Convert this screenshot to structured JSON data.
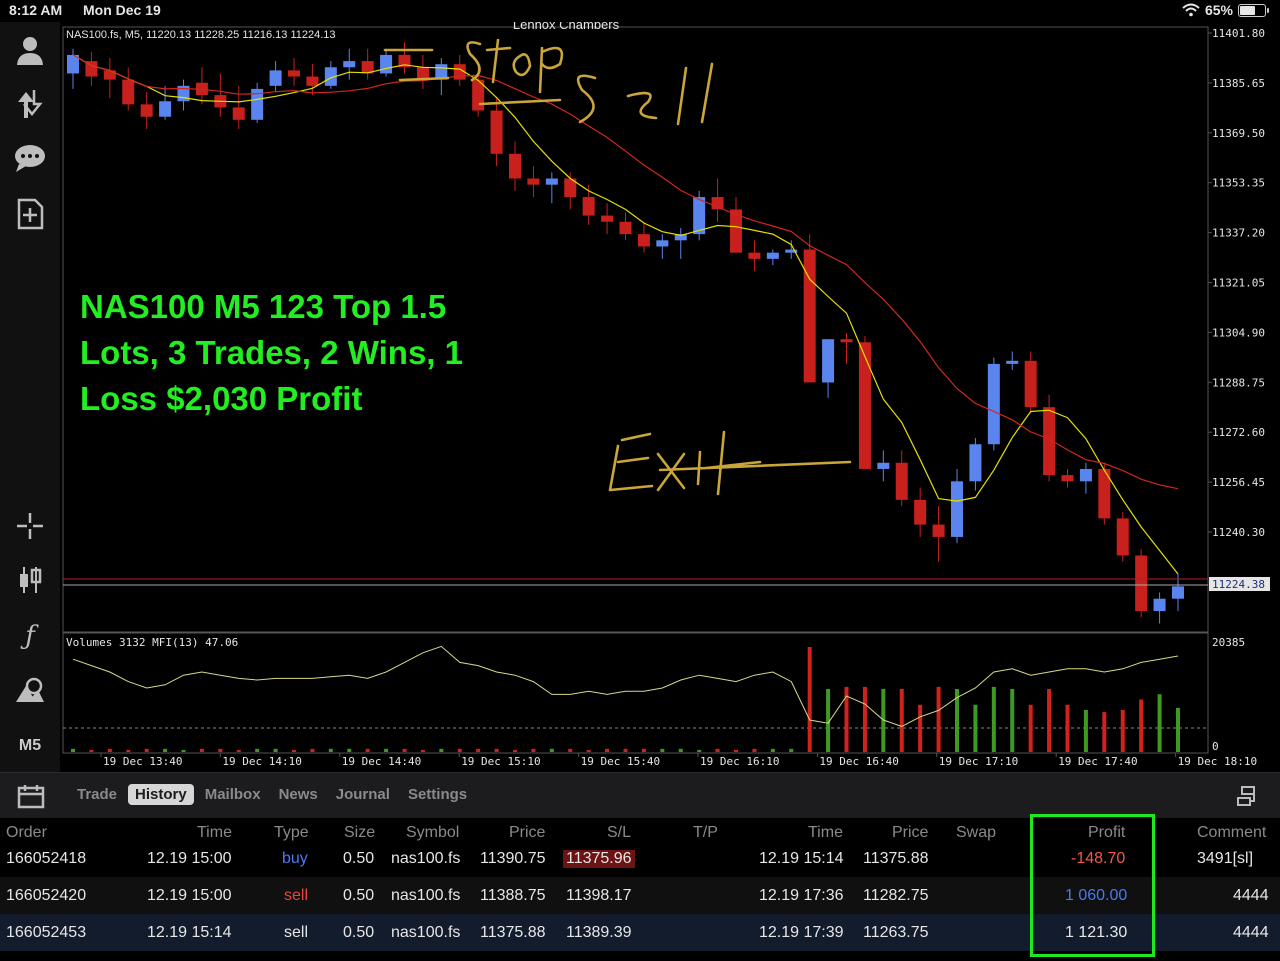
{
  "status_bar": {
    "time": "8:12 AM",
    "date": "Mon Dec 19",
    "battery": "65%",
    "battery_level": 0.65
  },
  "chart": {
    "owner": "Lennox Chambers",
    "info_line": "NAS100.fs, M5, 11220.13 11228.25 11216.13 11224.13",
    "annotation_lines": [
      "NAS100 M5 123 Top 1.5",
      "Lots, 3 Trades, 2 Wins, 1",
      "Loss $2,030 Profit"
    ],
    "current_price_label": "11224.38",
    "price_axis": [
      "11401.80",
      "11385.65",
      "11369.50",
      "11353.35",
      "11337.20",
      "11321.05",
      "11304.90",
      "11288.75",
      "11272.60",
      "11256.45",
      "11240.30",
      "11224.38"
    ],
    "volume_label": "Volumes 3132 MFI(13) 47.06",
    "volume_axis": [
      "20385",
      "0"
    ],
    "time_axis": [
      "19 Dec 13:40",
      "19 Dec 14:10",
      "19 Dec 14:40",
      "19 Dec 15:10",
      "19 Dec 15:40",
      "19 Dec 16:10",
      "19 Dec 16:40",
      "19 Dec 17:10",
      "19 Dec 17:40",
      "19 Dec 18:10"
    ],
    "handwritten": [
      "Stop",
      "Sell",
      "Exit"
    ],
    "colors": {
      "bull": "#5b85ee",
      "bear": "#c8201c",
      "ma_fast": "#e6e000",
      "ma_slow": "#d0281e",
      "annotation": "#22ee22",
      "handwriting": "#c9a53a",
      "vol_up": "#3f9a24",
      "vol_down": "#d2221c"
    }
  },
  "toolbar": {
    "icons": [
      "account-icon",
      "trade-icon",
      "chat-icon",
      "new-order-icon",
      "crosshair-icon",
      "candles-icon",
      "indicators-icon",
      "objects-icon"
    ],
    "timeframe": "M5"
  },
  "tabs": [
    "Trade",
    "History",
    "Mailbox",
    "News",
    "Journal",
    "Settings"
  ],
  "active_tab": "History",
  "table": {
    "columns": [
      "Order",
      "Time",
      "Type",
      "Size",
      "Symbol",
      "Price",
      "S/L",
      "T/P",
      "Time",
      "Price",
      "Swap",
      "Profit",
      "Comment"
    ],
    "rows": [
      [
        "166052418",
        "12.19 15:00",
        "buy",
        "0.50",
        "nas100.fs",
        "11390.75",
        "11375.96",
        "",
        "12.19 15:14",
        "11375.88",
        "",
        "-148.70",
        "3491[sl]"
      ],
      [
        "166052420",
        "12.19 15:00",
        "sell",
        "0.50",
        "nas100.fs",
        "11388.75",
        "11398.17",
        "",
        "12.19 17:36",
        "11282.75",
        "",
        "1 060.00",
        "4444"
      ],
      [
        "166052453",
        "12.19 15:14",
        "sell",
        "0.50",
        "nas100.fs",
        "11375.88",
        "11389.39",
        "",
        "12.19 17:39",
        "11263.75",
        "",
        "1 121.30",
        "4444"
      ]
    ]
  }
}
